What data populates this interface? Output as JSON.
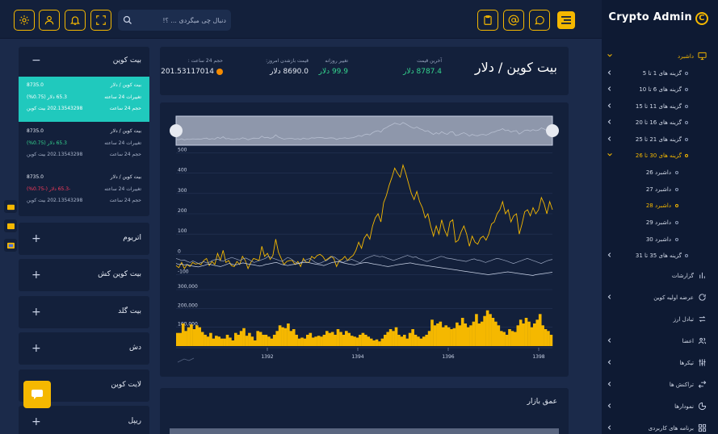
{
  "brand": {
    "name": "Crypto Admin",
    "mark": "C"
  },
  "search": {
    "placeholder": "دنبال چی میگردی ... ؟!"
  },
  "sidebar": {
    "items": [
      {
        "label": "داشبرد",
        "type": "menu",
        "active": true,
        "icon": "monitor-icon",
        "chevron": "down"
      },
      {
        "label": "گزینه های 1 تا 5",
        "type": "sub",
        "chevron": "left"
      },
      {
        "label": "گزینه های 6 تا 10",
        "type": "sub",
        "chevron": "left"
      },
      {
        "label": "گزینه های 11 تا 15",
        "type": "sub",
        "chevron": "left"
      },
      {
        "label": "گزینه های 16 تا 20",
        "type": "sub",
        "chevron": "left"
      },
      {
        "label": "گزینه های 21 تا 25",
        "type": "sub",
        "chevron": "left"
      },
      {
        "label": "گزینه های 30 تا 26",
        "type": "sub",
        "active": true,
        "chevron": "down"
      },
      {
        "label": "داشبرد 26",
        "type": "subsub"
      },
      {
        "label": "داشبرد 27",
        "type": "subsub"
      },
      {
        "label": "داشبرد 28",
        "type": "subsub",
        "active": true
      },
      {
        "label": "داشبرد 29",
        "type": "subsub"
      },
      {
        "label": "داشبرد 30",
        "type": "subsub"
      },
      {
        "label": "گزینه های 35 تا 31",
        "type": "sub",
        "chevron": "left"
      },
      {
        "label": "گزارشات",
        "type": "menu",
        "icon": "bar-chart-icon"
      },
      {
        "label": "عرضه اولیه کوین",
        "type": "menu",
        "icon": "refresh-icon",
        "chevron": "left"
      },
      {
        "label": "تبادل ارز",
        "type": "menu",
        "icon": "exchange-icon"
      },
      {
        "label": "اعضا",
        "type": "menu",
        "icon": "users-icon",
        "chevron": "left"
      },
      {
        "label": "تیکرها",
        "type": "menu",
        "icon": "sliders-icon",
        "chevron": "left"
      },
      {
        "label": "تراکنش ها",
        "type": "menu",
        "icon": "transfer-icon",
        "chevron": "left"
      },
      {
        "label": "نمودارها",
        "type": "menu",
        "icon": "pie-chart-icon",
        "chevron": "left"
      },
      {
        "label": "برنامه های کاربردی",
        "type": "menu",
        "icon": "grid-icon",
        "chevron": "left"
      }
    ]
  },
  "market": {
    "title": "بیت کوین / دلار",
    "stats": [
      {
        "label": "آخرین قیمت",
        "value": "8787.4 دلار",
        "highlight": true
      },
      {
        "label": "تغییر روزانه",
        "value": "99.9 دلار",
        "highlight": true
      },
      {
        "label": "قیمت بازشدن امروز:",
        "value": "8690.0 دلار",
        "highlight": false
      },
      {
        "label": "حجم 24 ساعت :",
        "value": "201.53117014",
        "highlight": false
      }
    ]
  },
  "depth": {
    "title": "عمق بازار"
  },
  "coins": {
    "expanded": {
      "title": "بیت کوین",
      "toggle": "−"
    },
    "rows": [
      {
        "pair": "بیت کوین / دلار",
        "price": "8735.0",
        "change_label": "تغییرات 24 ساعته",
        "change": "65.3 دلار (0.75%)",
        "volume_label": "حجم 24 ساعت",
        "volume": "202.13543298 بیت کوین",
        "selected": true,
        "trend": "up"
      },
      {
        "pair": "بیت کوین / دلار",
        "price": "8735.0",
        "change_label": "تغییرات 24 ساعته",
        "change": "65.3 دلار (0.75%)",
        "volume_label": "حجم 24 ساعت",
        "volume": "202.13543298 بیت کوین",
        "selected": false,
        "trend": "up"
      },
      {
        "pair": "بیت کوین / دلار",
        "price": "8735.0",
        "change_label": "تغییرات 24 ساعته",
        "change": "-65.3 دلار (-0.75%)",
        "volume_label": "حجم 24 ساعت",
        "volume": "202.13543298 بیت کوین",
        "selected": false,
        "trend": "down"
      }
    ],
    "collapsed": [
      {
        "title": "اتریوم",
        "toggle": "+"
      },
      {
        "title": "بیت کوین کش",
        "toggle": "+"
      },
      {
        "title": "بیت گلد",
        "toggle": "+"
      },
      {
        "title": "دش",
        "toggle": "+"
      },
      {
        "title": "لایت کوین",
        "toggle": "+"
      },
      {
        "title": "ریپل",
        "toggle": "+"
      }
    ]
  },
  "colors": {
    "accent": "#f5b800",
    "teal": "#20c9bd",
    "green": "#35d68f",
    "red": "#ff3b5c",
    "panel": "#13203b",
    "bg": "#1b2a4a"
  },
  "chart_data": {
    "type": "line",
    "x_ticks": [
      "1392",
      "1394",
      "1396",
      "1398"
    ],
    "price_axis": {
      "ticks": [
        500,
        400,
        300,
        200,
        100,
        0,
        -100
      ],
      "ylim": [
        -110,
        510
      ]
    },
    "volume_axis": {
      "ticks": [
        "300,000",
        "200,000",
        "100,000"
      ],
      "ylim": [
        0,
        300000
      ]
    },
    "series": [
      {
        "type": "line",
        "color": "#f5b800",
        "values": [
          -55,
          -65,
          -40,
          -70,
          -50,
          -60,
          -40,
          -48,
          -45,
          -50,
          -30,
          -20,
          -55,
          -35,
          -50,
          5,
          -30,
          20,
          -40,
          -30,
          -55,
          -60,
          -35,
          -50,
          -10,
          -30,
          -70,
          -40,
          -20,
          -25,
          -30,
          40,
          -10,
          5,
          -25,
          -5,
          75,
          10,
          -20,
          -50,
          -35,
          -30,
          -30,
          -50,
          -35,
          -60,
          -20,
          -40,
          -40,
          -10,
          -20,
          -5,
          0,
          -10,
          -30,
          -20,
          -10,
          -20,
          -60,
          -30,
          -25,
          -10,
          -30,
          -15,
          -5,
          20,
          60,
          30,
          80,
          100,
          75,
          140,
          180,
          200,
          160,
          255,
          290,
          340,
          380,
          425,
          400,
          380,
          440,
          400,
          350,
          300,
          270,
          310,
          260,
          230,
          180,
          200,
          140,
          90,
          140,
          100,
          170,
          120,
          90,
          160,
          170,
          60,
          70,
          110,
          140,
          100,
          40,
          90,
          60,
          50,
          80,
          90,
          70,
          100,
          150,
          160,
          200,
          220,
          260,
          200,
          220,
          160,
          190,
          200,
          100,
          150,
          210,
          220,
          190,
          230,
          200,
          220,
          280,
          250,
          200,
          260,
          220
        ]
      },
      {
        "type": "line",
        "color": "#9aa6c0",
        "values": [
          -20,
          -25,
          -30,
          -28,
          -35,
          -40,
          -32,
          -38,
          -45,
          -40,
          -36,
          -42,
          -38,
          -30,
          -26,
          -24,
          -30,
          -34,
          -25,
          -20,
          -15,
          -20,
          -25,
          -30,
          -22,
          -18,
          -24,
          -32,
          -40,
          -35,
          -30,
          -25,
          -20,
          -10,
          -15,
          -20,
          -25,
          -30,
          -35,
          -25,
          -15,
          -20,
          -30,
          -40,
          -45,
          -38,
          -30,
          -25,
          -20,
          -30,
          -40,
          -45,
          -42,
          -35,
          -30,
          -20,
          -10,
          -15,
          -25,
          -35,
          -40,
          -32,
          -28,
          -24,
          -30,
          -36,
          -42,
          -30,
          -20,
          -15,
          -10,
          -5,
          -8,
          -12,
          -10,
          -15,
          -20,
          -25,
          -30,
          -25,
          -20,
          -15,
          -10,
          -5,
          -10,
          -15,
          -12,
          -20,
          -25,
          -30,
          -35,
          -30,
          -25,
          -20,
          -15,
          -10,
          -12,
          -18,
          -20,
          -22,
          -25,
          -28,
          -30,
          -32,
          -35,
          -30,
          -25,
          -22,
          -28,
          -30,
          -35,
          -40,
          -35,
          -30,
          -25,
          -20,
          -22,
          -26,
          -30,
          -35,
          -40,
          -45,
          -40,
          -35,
          -30,
          -25,
          -20,
          -25,
          -30,
          -35,
          -40,
          -45,
          -38,
          -32,
          -28,
          -25
        ]
      },
      {
        "type": "line",
        "color": "#c9d2e6",
        "values": [
          -45,
          -50,
          -48,
          -52,
          -50,
          -55,
          -58,
          -60,
          -62,
          -58,
          -55,
          -50,
          -48,
          -52,
          -55,
          -58,
          -60,
          -55,
          -50,
          -45,
          -48,
          -52,
          -50,
          -46,
          -42,
          -45,
          -48,
          -50,
          -52,
          -55,
          -58,
          -55,
          -50,
          -48,
          -45,
          -42,
          -40,
          -45,
          -50,
          -52,
          -55,
          -52,
          -50,
          -48,
          -45,
          -42,
          -40,
          -38,
          -42,
          -45,
          -48,
          -50,
          -52,
          -55,
          -50,
          -45,
          -40,
          -38,
          -35,
          -38,
          -42,
          -45,
          -48,
          -50,
          -52,
          -48,
          -45,
          -42,
          -40,
          -42,
          -45,
          -48,
          -50,
          -52,
          -55,
          -58,
          -60,
          -58,
          -55,
          -52,
          -50,
          -48,
          -46,
          -44,
          -42,
          -45,
          -48,
          -50,
          -52,
          -54,
          -56,
          -58,
          -60,
          -62,
          -64,
          -66,
          -68,
          -70,
          -72,
          -74,
          -76,
          -78,
          -80,
          -82,
          -84,
          -86,
          -88,
          -90,
          -92,
          -94,
          -96,
          -98,
          -100,
          -98,
          -96,
          -94,
          -92,
          -90,
          -88,
          -86,
          -88,
          -90,
          -92,
          -94,
          -96,
          -98,
          -100,
          -102,
          -104,
          -100,
          -98,
          -96,
          -94,
          -92,
          -90,
          -88
        ]
      },
      {
        "type": "bar",
        "color": "#f5b800",
        "values": [
          70000,
          70000,
          120000,
          80000,
          100000,
          115000,
          90000,
          110000,
          100000,
          75000,
          60000,
          50000,
          70000,
          40000,
          55000,
          50000,
          40000,
          40000,
          60000,
          45000,
          30000,
          70000,
          60000,
          80000,
          95000,
          55000,
          70000,
          50000,
          30000,
          80000,
          75000,
          60000,
          60000,
          50000,
          40000,
          60000,
          80000,
          110000,
          100000,
          95000,
          120000,
          80000,
          90000,
          60000,
          40000,
          45000,
          40000,
          60000,
          70000,
          45000,
          50000,
          55000,
          50000,
          60000,
          80000,
          70000,
          75000,
          60000,
          90000,
          75000,
          60000,
          80000,
          70000,
          55000,
          50000,
          45000,
          60000,
          70000,
          60000,
          50000,
          40000,
          30000,
          35000,
          25000,
          40000,
          60000,
          75000,
          90000,
          80000,
          100000,
          60000,
          50000,
          60000,
          40000,
          70000,
          90000,
          60000,
          50000,
          40000,
          50000,
          60000,
          80000,
          140000,
          110000,
          120000,
          130000,
          100000,
          110000,
          100000,
          90000,
          95000,
          125000,
          110000,
          150000,
          120000,
          100000,
          110000,
          130000,
          170000,
          120000,
          130000,
          160000,
          190000,
          170000,
          150000,
          130000,
          110000,
          80000,
          75000,
          60000,
          90000,
          80000,
          75000,
          110000,
          140000,
          120000,
          150000,
          130000,
          100000,
          120000,
          140000,
          170000,
          110000,
          90000,
          80000,
          60000
        ]
      }
    ]
  }
}
